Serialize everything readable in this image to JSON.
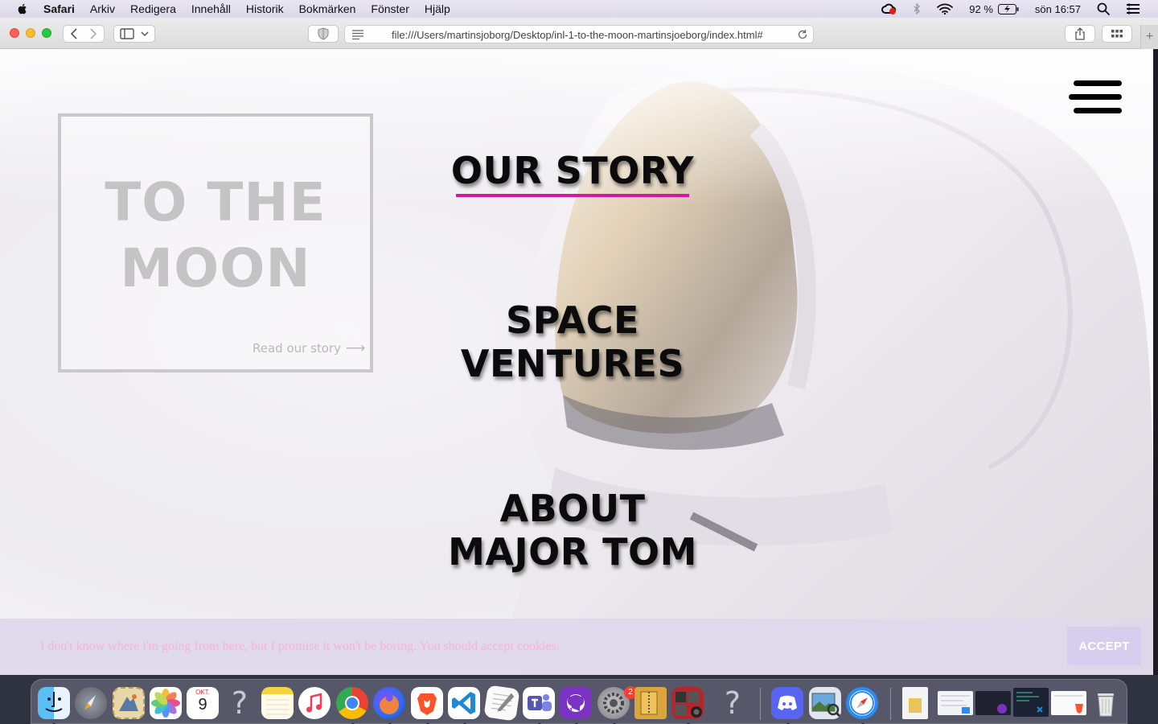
{
  "menubar": {
    "app_name": "Safari",
    "items": [
      "Arkiv",
      "Redigera",
      "Innehåll",
      "Historik",
      "Bokmärken",
      "Fönster",
      "Hjälp"
    ],
    "battery": "92 %",
    "clock": "sön 16:57"
  },
  "browser": {
    "url": "file:///Users/martinsjoborg/Desktop/inl-1-to-the-moon-martinsjoeborg/index.html#"
  },
  "page": {
    "logo": {
      "line1": "TO THE",
      "line2": "MOON"
    },
    "read_story": {
      "label": "Read our story",
      "arrow": "⟶"
    },
    "nav": {
      "our_story": "OUR STORY",
      "space_ventures": {
        "line1": "SPACE",
        "line2": "VENTURES"
      },
      "about_major_tom": {
        "line1": "ABOUT",
        "line2": "MAJOR TOM"
      }
    },
    "cookie": {
      "text": "I don't know where i'm going from here, but I promise it won't be boring. You should accept cookies.",
      "accept_label": "ACCEPT"
    }
  },
  "colors": {
    "accent_underline": "#d4189f",
    "cookie_text": "#f3b6de",
    "accept_bg": "#d7cdee"
  },
  "dock": {
    "apps": [
      "finder-icon",
      "launchpad-icon",
      "mail-icon",
      "photos-icon",
      "calendar-icon",
      "unknown-app-icon",
      "notes-icon",
      "music-icon",
      "chrome-icon",
      "firefox-icon",
      "brave-icon",
      "vscode-icon",
      "textedit-icon",
      "teams-icon",
      "github-desktop-icon",
      "system-preferences-icon",
      "archive-utility-icon",
      "photo-booth-icon",
      "unknown-app-icon",
      "discord-icon",
      "preview-icon",
      "safari-icon"
    ],
    "calendar": {
      "month": "OKT.",
      "day": "9"
    },
    "system_prefs_badge": "2"
  }
}
